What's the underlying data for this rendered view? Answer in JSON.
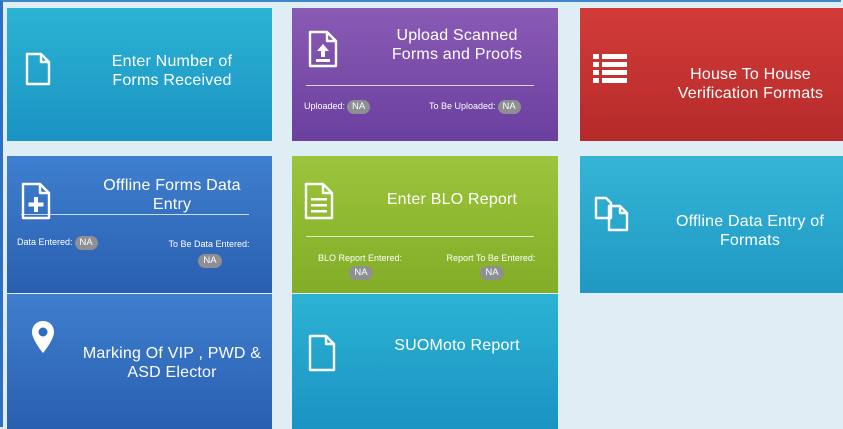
{
  "tiles": {
    "forms_received": {
      "title": "Enter Number of Forms Received"
    },
    "upload_scanned": {
      "title": "Upload Scanned Forms and Proofs",
      "uploaded_label": "Uploaded:",
      "uploaded_value": "NA",
      "to_be_uploaded_label": "To Be Uploaded:",
      "to_be_uploaded_value": "NA"
    },
    "house_verification": {
      "title": "House To House Verification Formats"
    },
    "offline_forms": {
      "title": "Offline Forms Data Entry",
      "data_entered_label": "Data Entered:",
      "data_entered_value": "NA",
      "to_be_entered_label": "To Be Data Entered:",
      "to_be_entered_value": "NA"
    },
    "blo_report": {
      "title": "Enter BLO Report",
      "entered_label": "BLO Report Entered:",
      "entered_value": "NA",
      "to_be_entered_label": "Report To Be Entered:",
      "to_be_entered_value": "NA"
    },
    "offline_formats": {
      "title": "Offline Data Entry of Formats"
    },
    "marking_vip": {
      "title": "Marking Of VIP , PWD & ASD Elector"
    },
    "suomoto": {
      "title": "SUOMoto Report"
    }
  },
  "colors": {
    "cyan": "#1a93c2",
    "purple": "#6a3f9e",
    "red": "#b52a2a",
    "blue": "#2a5fb0",
    "green": "#83ad27",
    "badge": "#8d8f93",
    "background": "#dfeef5"
  },
  "icons": {
    "forms_received": "document-icon",
    "upload_scanned": "upload-file-icon",
    "house_verification": "list-icon",
    "offline_forms": "add-document-icon",
    "blo_report": "text-document-icon",
    "offline_formats": "copy-files-icon",
    "marking_vip": "map-marker-icon",
    "suomoto": "document-icon"
  }
}
